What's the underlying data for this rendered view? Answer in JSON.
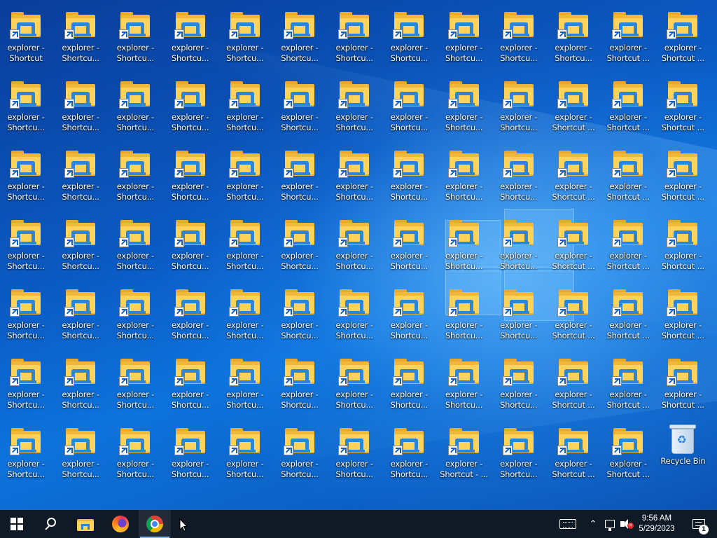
{
  "desktop": {
    "rows": [
      [
        [
          "explorer -",
          "Shortcut"
        ],
        [
          "explorer -",
          "Shortcu..."
        ],
        [
          "explorer -",
          "Shortcu..."
        ],
        [
          "explorer -",
          "Shortcu..."
        ],
        [
          "explorer -",
          "Shortcu..."
        ],
        [
          "explorer -",
          "Shortcu..."
        ],
        [
          "explorer -",
          "Shortcu..."
        ],
        [
          "explorer -",
          "Shortcu..."
        ],
        [
          "explorer -",
          "Shortcu..."
        ],
        [
          "explorer -",
          "Shortcu..."
        ],
        [
          "explorer -",
          "Shortcu..."
        ],
        [
          "explorer -",
          "Shortcut ..."
        ],
        [
          "explorer -",
          "Shortcut ..."
        ]
      ],
      [
        [
          "explorer -",
          "Shortcu..."
        ],
        [
          "explorer -",
          "Shortcu..."
        ],
        [
          "explorer -",
          "Shortcu..."
        ],
        [
          "explorer -",
          "Shortcu..."
        ],
        [
          "explorer -",
          "Shortcu..."
        ],
        [
          "explorer -",
          "Shortcu..."
        ],
        [
          "explorer -",
          "Shortcu..."
        ],
        [
          "explorer -",
          "Shortcu..."
        ],
        [
          "explorer -",
          "Shortcu..."
        ],
        [
          "explorer -",
          "Shortcu..."
        ],
        [
          "explorer -",
          "Shortcut ..."
        ],
        [
          "explorer -",
          "Shortcut ..."
        ],
        [
          "explorer -",
          "Shortcut ..."
        ]
      ],
      [
        [
          "explorer -",
          "Shortcu..."
        ],
        [
          "explorer -",
          "Shortcu..."
        ],
        [
          "explorer -",
          "Shortcu..."
        ],
        [
          "explorer -",
          "Shortcu..."
        ],
        [
          "explorer -",
          "Shortcu..."
        ],
        [
          "explorer -",
          "Shortcu..."
        ],
        [
          "explorer -",
          "Shortcu..."
        ],
        [
          "explorer -",
          "Shortcu..."
        ],
        [
          "explorer -",
          "Shortcu..."
        ],
        [
          "explorer -",
          "Shortcu..."
        ],
        [
          "explorer -",
          "Shortcut ..."
        ],
        [
          "explorer -",
          "Shortcut ..."
        ],
        [
          "explorer -",
          "Shortcut ..."
        ]
      ],
      [
        [
          "explorer -",
          "Shortcu..."
        ],
        [
          "explorer -",
          "Shortcu..."
        ],
        [
          "explorer -",
          "Shortcu..."
        ],
        [
          "explorer -",
          "Shortcu..."
        ],
        [
          "explorer -",
          "Shortcu..."
        ],
        [
          "explorer -",
          "Shortcu..."
        ],
        [
          "explorer -",
          "Shortcu..."
        ],
        [
          "explorer -",
          "Shortcu..."
        ],
        [
          "explorer -",
          "Shortcu..."
        ],
        [
          "explorer -",
          "Shortcu..."
        ],
        [
          "explorer -",
          "Shortcut ..."
        ],
        [
          "explorer -",
          "Shortcut ..."
        ],
        [
          "explorer -",
          "Shortcut ..."
        ]
      ],
      [
        [
          "explorer -",
          "Shortcu..."
        ],
        [
          "explorer -",
          "Shortcu..."
        ],
        [
          "explorer -",
          "Shortcu..."
        ],
        [
          "explorer -",
          "Shortcu..."
        ],
        [
          "explorer -",
          "Shortcu..."
        ],
        [
          "explorer -",
          "Shortcu..."
        ],
        [
          "explorer -",
          "Shortcu..."
        ],
        [
          "explorer -",
          "Shortcu..."
        ],
        [
          "explorer -",
          "Shortcu..."
        ],
        [
          "explorer -",
          "Shortcu..."
        ],
        [
          "explorer -",
          "Shortcut ..."
        ],
        [
          "explorer -",
          "Shortcut ..."
        ],
        [
          "explorer -",
          "Shortcut ..."
        ]
      ],
      [
        [
          "explorer -",
          "Shortcu..."
        ],
        [
          "explorer -",
          "Shortcu..."
        ],
        [
          "explorer -",
          "Shortcu..."
        ],
        [
          "explorer -",
          "Shortcu..."
        ],
        [
          "explorer -",
          "Shortcu..."
        ],
        [
          "explorer -",
          "Shortcu..."
        ],
        [
          "explorer -",
          "Shortcu..."
        ],
        [
          "explorer -",
          "Shortcu..."
        ],
        [
          "explorer -",
          "Shortcu..."
        ],
        [
          "explorer -",
          "Shortcu..."
        ],
        [
          "explorer -",
          "Shortcut ..."
        ],
        [
          "explorer -",
          "Shortcut ..."
        ],
        [
          "explorer -",
          "Shortcut ..."
        ]
      ],
      [
        [
          "explorer -",
          "Shortcu..."
        ],
        [
          "explorer -",
          "Shortcu..."
        ],
        [
          "explorer -",
          "Shortcu..."
        ],
        [
          "explorer -",
          "Shortcu..."
        ],
        [
          "explorer -",
          "Shortcu..."
        ],
        [
          "explorer -",
          "Shortcu..."
        ],
        [
          "explorer -",
          "Shortcu..."
        ],
        [
          "explorer -",
          "Shortcu..."
        ],
        [
          "explorer -",
          "Shortcut - ..."
        ],
        [
          "explorer -",
          "Shortcu..."
        ],
        [
          "explorer -",
          "Shortcut ..."
        ],
        [
          "explorer -",
          "Shortcut ..."
        ]
      ]
    ],
    "recycle_bin_label": "Recycle Bin",
    "icon_type": "folder-shortcut-icon"
  },
  "taskbar": {
    "pinned": [
      {
        "name": "start-button",
        "icon": "windows-logo-icon"
      },
      {
        "name": "search-button",
        "icon": "search-icon"
      },
      {
        "name": "file-explorer-button",
        "icon": "folder-icon"
      },
      {
        "name": "firefox-button",
        "icon": "firefox-icon"
      },
      {
        "name": "chrome-button",
        "icon": "chrome-icon",
        "active": true
      }
    ],
    "tray": {
      "time": "9:56 AM",
      "date": "5/29/2023",
      "notification_count": "1"
    },
    "colors": {
      "background": "#101a26",
      "active_underline": "#7fb8ee"
    }
  }
}
